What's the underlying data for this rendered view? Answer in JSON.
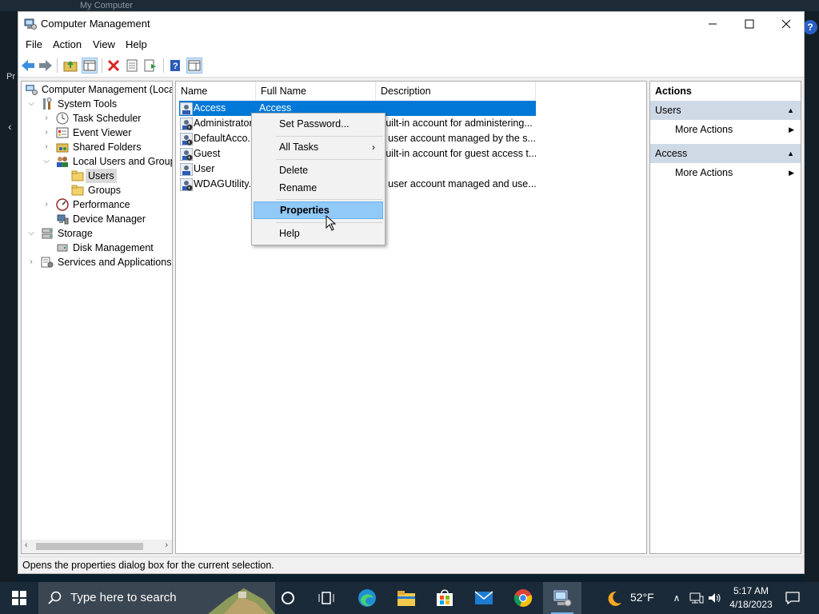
{
  "background": {
    "title": "My Computer",
    "left_text": "Pr"
  },
  "window": {
    "title": "Computer Management",
    "menu": [
      "File",
      "Action",
      "View",
      "Help"
    ]
  },
  "tree": {
    "items": [
      {
        "label": "Computer Management (Local"
      },
      {
        "label": "System Tools"
      },
      {
        "label": "Task Scheduler"
      },
      {
        "label": "Event Viewer"
      },
      {
        "label": "Shared Folders"
      },
      {
        "label": "Local Users and Groups"
      },
      {
        "label": "Users"
      },
      {
        "label": "Groups"
      },
      {
        "label": "Performance"
      },
      {
        "label": "Device Manager"
      },
      {
        "label": "Storage"
      },
      {
        "label": "Disk Management"
      },
      {
        "label": "Services and Applications"
      }
    ]
  },
  "list": {
    "columns": [
      "Name",
      "Full Name",
      "Description"
    ],
    "rows": [
      {
        "name": "Access",
        "full_name": "Access",
        "description": ""
      },
      {
        "name": "Administrator",
        "full_name": "",
        "description": "Built-in account for administering..."
      },
      {
        "name": "DefaultAcco...",
        "full_name": "",
        "description": "A user account managed by the s..."
      },
      {
        "name": "Guest",
        "full_name": "",
        "description": "Built-in account for guest access t..."
      },
      {
        "name": "User",
        "full_name": "",
        "description": ""
      },
      {
        "name": "WDAGUtility...",
        "full_name": "",
        "description": "A user account managed and use..."
      }
    ]
  },
  "context_menu": {
    "items": [
      "Set Password...",
      "All Tasks",
      "Delete",
      "Rename",
      "Properties",
      "Help"
    ],
    "highlighted": "Properties"
  },
  "actions": {
    "title": "Actions",
    "sections": [
      {
        "header": "Users",
        "item": "More Actions"
      },
      {
        "header": "Access",
        "item": "More Actions"
      }
    ]
  },
  "status": "Opens the properties dialog box for the current selection.",
  "taskbar": {
    "search_placeholder": "Type here to search",
    "temperature": "52°F",
    "time": "5:17 AM",
    "date": "4/18/2023"
  },
  "colors": {
    "selection": "#0078d7",
    "menu_highlight": "#91c9f7",
    "actions_header": "#cfd9e6",
    "taskbar": "#1a2a38"
  }
}
